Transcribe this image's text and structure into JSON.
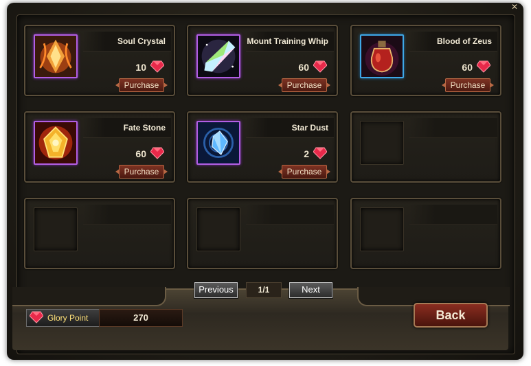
{
  "window": {
    "close_icon": "close-icon"
  },
  "items": [
    {
      "name": "Soul Crystal",
      "price": "10",
      "button": "Purchase",
      "frame": "purple",
      "icon": "soul-crystal-icon"
    },
    {
      "name": "Mount Training Whip",
      "price": "60",
      "button": "Purchase",
      "frame": "purple",
      "icon": "mount-training-whip-icon"
    },
    {
      "name": "Blood of Zeus",
      "price": "60",
      "button": "Purchase",
      "frame": "blue",
      "icon": "blood-of-zeus-icon"
    },
    {
      "name": "Fate Stone",
      "price": "60",
      "button": "Purchase",
      "frame": "purple",
      "icon": "fate-stone-icon"
    },
    {
      "name": "Star Dust",
      "price": "2",
      "button": "Purchase",
      "frame": "purple",
      "icon": "star-dust-icon"
    }
  ],
  "pagination": {
    "previous": "Previous",
    "page": "1/1",
    "next": "Next"
  },
  "glory": {
    "label": "Glory Point",
    "value": "270",
    "icon": "red-gem-icon"
  },
  "back": "Back",
  "colors": {
    "accent_red": "#7d3222",
    "frame_purple": "#b25fe4",
    "frame_blue": "#3ea8e8",
    "gold_text": "#ffe27a"
  }
}
